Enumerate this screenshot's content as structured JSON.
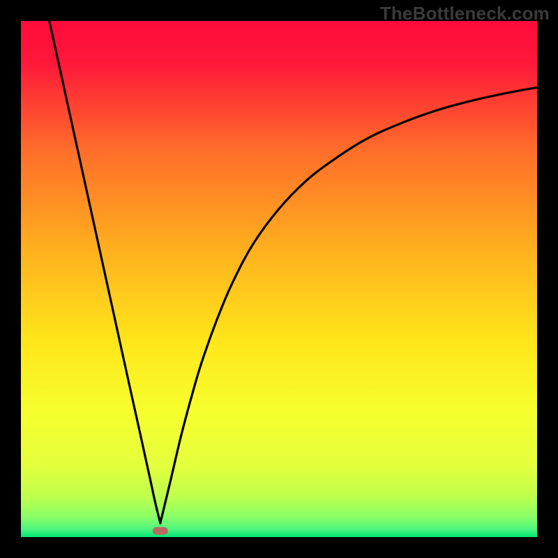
{
  "watermark": "TheBottleneck.com",
  "chart_data": {
    "type": "line",
    "title": "",
    "xlabel": "",
    "ylabel": "",
    "xlim": [
      0,
      100
    ],
    "ylim": [
      0,
      100
    ],
    "grid": false,
    "legend": false,
    "annotations": [],
    "background_gradient": {
      "top": "#ff0b3b",
      "upper_mid": "#ff8a22",
      "mid": "#ffd61a",
      "lower_mid": "#f6ff2e",
      "near_bottom": "#a8ff5a",
      "bottom": "#00e676"
    },
    "marker": {
      "x": 27,
      "y": 1.2,
      "color": "#b86a60",
      "shape": "rounded-rect"
    },
    "series": [
      {
        "name": "left-branch",
        "x": [
          5.5,
          7,
          9,
          11,
          13,
          15,
          17,
          19,
          21,
          23,
          25,
          26,
          27
        ],
        "y": [
          100,
          93.2,
          84.1,
          75.0,
          65.9,
          56.8,
          47.7,
          38.6,
          29.5,
          20.5,
          11.4,
          6.8,
          2.7
        ]
      },
      {
        "name": "right-branch",
        "x": [
          27,
          29,
          31,
          33,
          35,
          38,
          41,
          45,
          50,
          55,
          60,
          66,
          72,
          80,
          88,
          96,
          100
        ],
        "y": [
          2.7,
          11.0,
          19.5,
          27.0,
          33.8,
          42.2,
          49.3,
          56.8,
          63.6,
          68.8,
          72.7,
          76.6,
          79.5,
          82.5,
          84.7,
          86.4,
          87.1
        ]
      }
    ]
  }
}
